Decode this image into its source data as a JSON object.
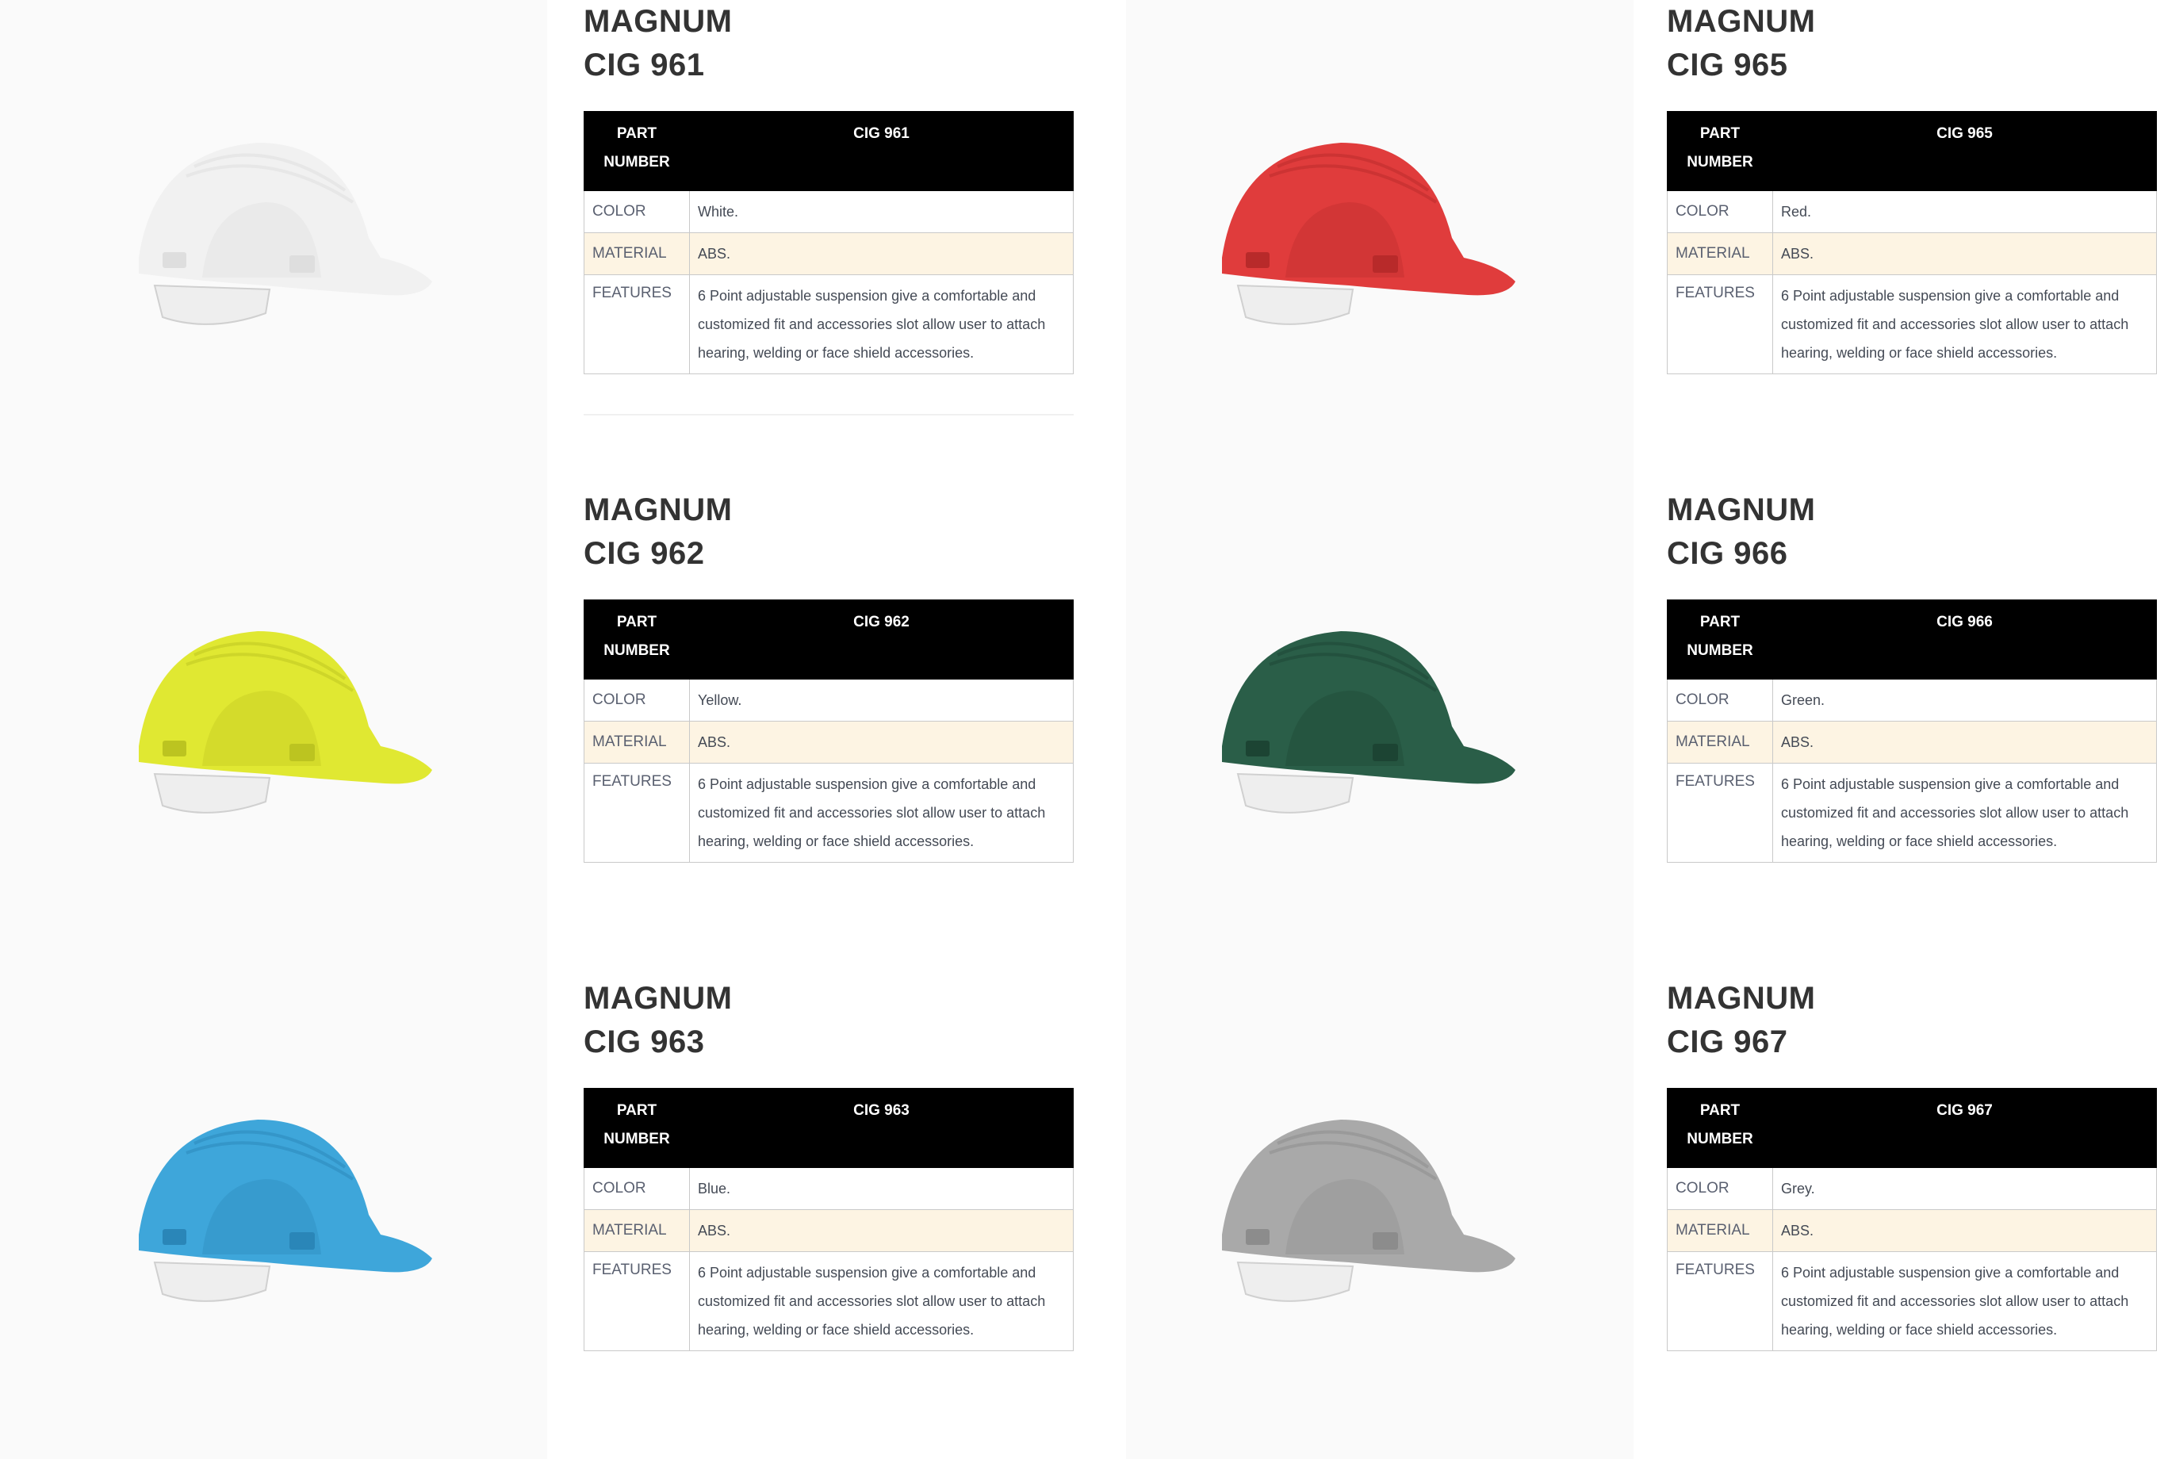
{
  "products": [
    {
      "brand": "MAGNUM",
      "model": "CIG 961",
      "header_part": "PART NUMBER",
      "header_value": "CIG 961",
      "rows": [
        {
          "label": "COLOR",
          "value": "White."
        },
        {
          "label": "MATERIAL",
          "value": "ABS."
        },
        {
          "label": "FEATURES",
          "value": "6 Point adjustable suspension give a comfortable and customized fit and accessories slot allow user to attach hearing, welding or face shield accessories."
        }
      ],
      "helmet_color": "#f1f1f1",
      "helmet_shade": "#dedede",
      "helmet_name": "white-hard-hat-icon"
    },
    {
      "brand": "MAGNUM",
      "model": "CIG 965",
      "header_part": "PART NUMBER",
      "header_value": "CIG 965",
      "rows": [
        {
          "label": "COLOR",
          "value": "Red."
        },
        {
          "label": "MATERIAL",
          "value": "ABS."
        },
        {
          "label": "FEATURES",
          "value": "6 Point adjustable suspension give a comfortable and customized fit and accessories slot allow user to attach hearing, welding or face shield accessories."
        }
      ],
      "helmet_color": "#e03c3c",
      "helmet_shade": "#b82a2a",
      "helmet_name": "red-hard-hat-icon"
    },
    {
      "brand": "MAGNUM",
      "model": "CIG 962",
      "header_part": "PART NUMBER",
      "header_value": "CIG 962",
      "rows": [
        {
          "label": "COLOR",
          "value": "Yellow."
        },
        {
          "label": "MATERIAL",
          "value": "ABS."
        },
        {
          "label": "FEATURES",
          "value": "6 Point adjustable suspension give a comfortable and customized fit and accessories slot allow user to attach hearing, welding or face shield accessories."
        }
      ],
      "helmet_color": "#e0e832",
      "helmet_shade": "#bcc420",
      "helmet_name": "yellow-hard-hat-icon"
    },
    {
      "brand": "MAGNUM",
      "model": "CIG 966",
      "header_part": "PART NUMBER",
      "header_value": "CIG 966",
      "rows": [
        {
          "label": "COLOR",
          "value": "Green."
        },
        {
          "label": "MATERIAL",
          "value": "ABS."
        },
        {
          "label": "FEATURES",
          "value": "6 Point adjustable suspension give a comfortable and customized fit and accessories slot allow user to attach hearing, welding or face shield accessories."
        }
      ],
      "helmet_color": "#2a5e48",
      "helmet_shade": "#1c4433",
      "helmet_name": "green-hard-hat-icon"
    },
    {
      "brand": "MAGNUM",
      "model": "CIG 963",
      "header_part": "PART NUMBER",
      "header_value": "CIG 963",
      "rows": [
        {
          "label": "COLOR",
          "value": "Blue."
        },
        {
          "label": "MATERIAL",
          "value": "ABS."
        },
        {
          "label": "FEATURES",
          "value": "6 Point adjustable suspension give a comfortable and customized fit and accessories slot allow user to attach hearing, welding or face shield accessories."
        }
      ],
      "helmet_color": "#3ea6da",
      "helmet_shade": "#2a86b8",
      "helmet_name": "blue-hard-hat-icon"
    },
    {
      "brand": "MAGNUM",
      "model": "CIG 967",
      "header_part": "PART NUMBER",
      "header_value": "CIG 967",
      "rows": [
        {
          "label": "COLOR",
          "value": "Grey."
        },
        {
          "label": "MATERIAL",
          "value": "ABS."
        },
        {
          "label": "FEATURES",
          "value": "6 Point adjustable suspension give a comfortable and customized fit and accessories slot allow user to attach hearing, welding or face shield accessories."
        }
      ],
      "helmet_color": "#a9a9a9",
      "helmet_shade": "#8c8c8c",
      "helmet_name": "grey-hard-hat-icon"
    }
  ]
}
